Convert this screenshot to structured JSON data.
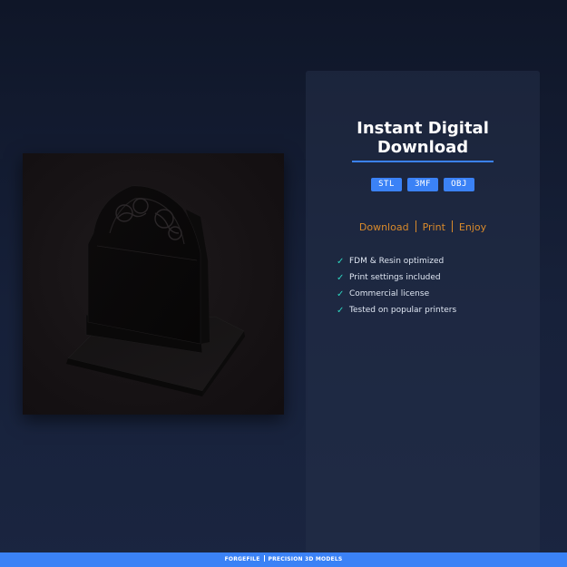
{
  "panel": {
    "title_line1": "Instant Digital",
    "title_line2": "Download",
    "formats": [
      "STL",
      "3MF",
      "OBJ"
    ],
    "tagline": [
      "Download",
      "Print",
      "Enjoy"
    ],
    "features": [
      "FDM & Resin optimized",
      "Print settings included",
      "Commercial license",
      "Tested on popular printers"
    ]
  },
  "footer": {
    "brand": "FORGEFILE",
    "subtitle": "PRECISION 3D MODELS"
  },
  "icons": {
    "feature_check": "check-icon",
    "product": "tombstone-model"
  },
  "colors": {
    "accent": "#3b82f6",
    "tagline": "#d98a2b",
    "check": "#2dd4bf"
  }
}
